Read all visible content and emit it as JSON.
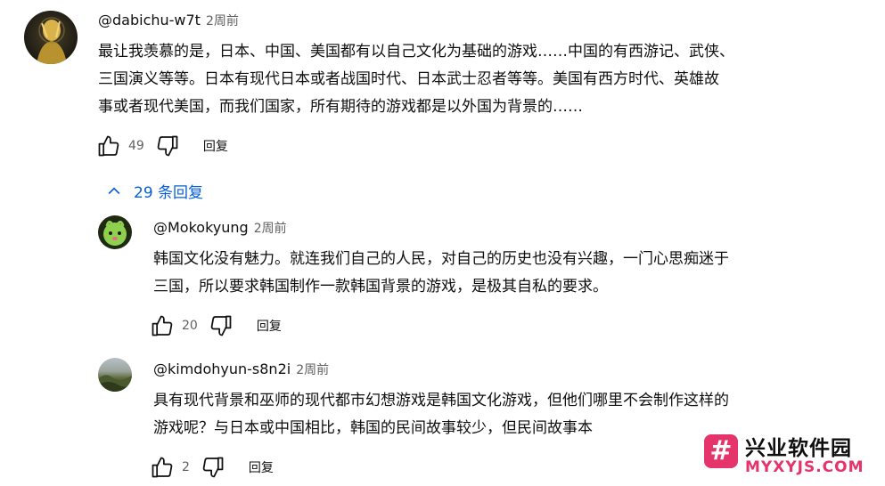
{
  "top_comment": {
    "author": "@dabichu-w7t",
    "time": "2周前",
    "lines": [
      "最让我羡慕的是，日本、中国、美国都有以自己文化为基础的游戏……中国的有西游记、武侠、",
      "三国演义等等。日本有现代日本或者战国时代、日本武士忍者等等。美国有西方时代、英雄故",
      "事或者现代美国，而我们国家，所有期待的游戏都是以外国为背景的……"
    ],
    "likes": "49",
    "reply_label": "回复"
  },
  "replies_toggle": {
    "count": "29",
    "label": "条回复"
  },
  "replies": [
    {
      "author": "@Mokokyung",
      "time": "2周前",
      "lines": [
        "韩国文化没有魅力。就连我们自己的人民，对自己的历史也没有兴趣，一门心思痴迷于",
        "三国，所以要求韩国制作一款韩国背景的游戏，是极其自私的要求。"
      ],
      "likes": "20",
      "reply_label": "回复"
    },
    {
      "author": "@kimdohyun-s8n2i",
      "time": "2周前",
      "lines": [
        "具有现代背景和巫师的现代都市幻想游戏是韩国文化游戏，但他们哪里不会制作这样的",
        "游戏呢？与日本或中国相比，韩国的民间故事较少，但民间故事本"
      ],
      "likes": "2",
      "reply_label": "回复"
    }
  ],
  "watermark": {
    "title": "兴业软件园",
    "url": "MYXYJS.COM",
    "logo_glyph": "#"
  },
  "colors": {
    "link_blue": "#065fd4",
    "meta_gray": "#606060",
    "watermark_pink": "#e5336b"
  }
}
